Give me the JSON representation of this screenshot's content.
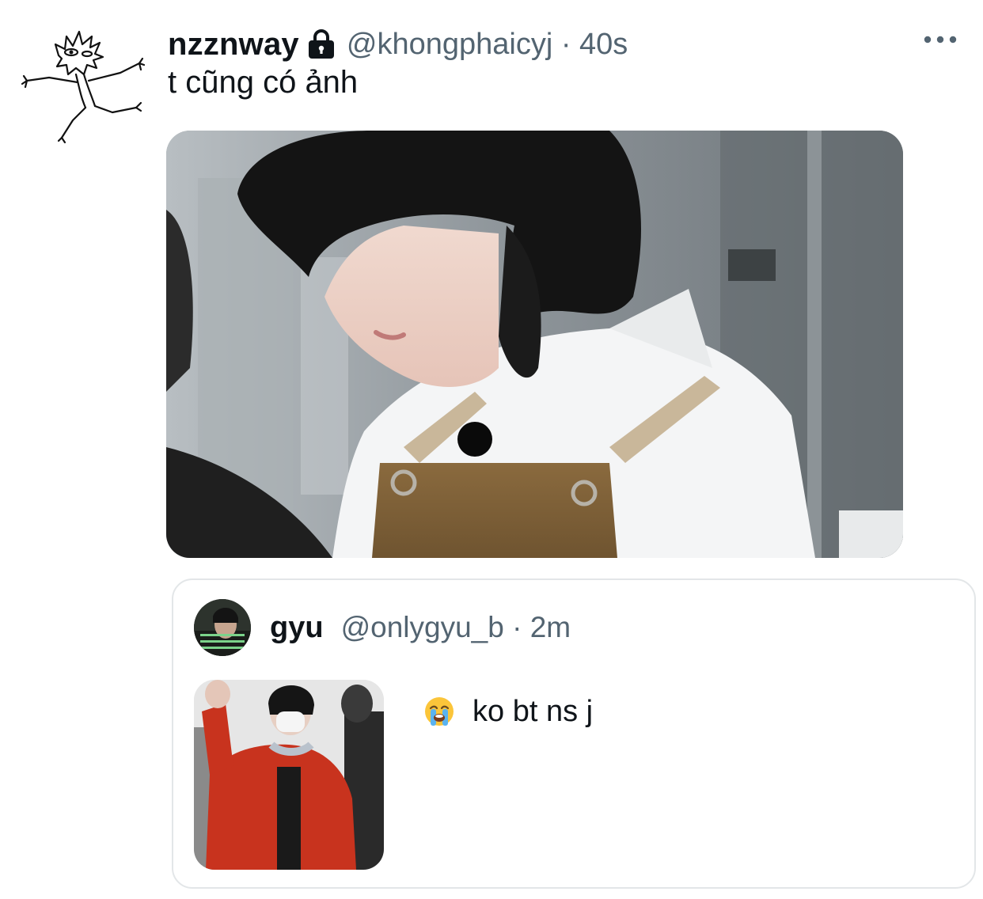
{
  "tweet": {
    "display_name": "nzznway",
    "protected_icon": "lock-icon",
    "handle_time": "@khongphaicyj · 40s",
    "text": "t cũng có ảnh",
    "more_icon": "more-horizontal-icon",
    "media_alt": "photo"
  },
  "quoted_tweet": {
    "display_name": "gyu",
    "handle_time": "@onlygyu_b · 2m",
    "emoji_icon": "loudly-crying-face-icon",
    "text": "ko bt ns j",
    "media_alt": "photo"
  },
  "colors": {
    "primary_text": "#0f1419",
    "secondary_text": "#536471",
    "border": "#e3e6e8"
  }
}
